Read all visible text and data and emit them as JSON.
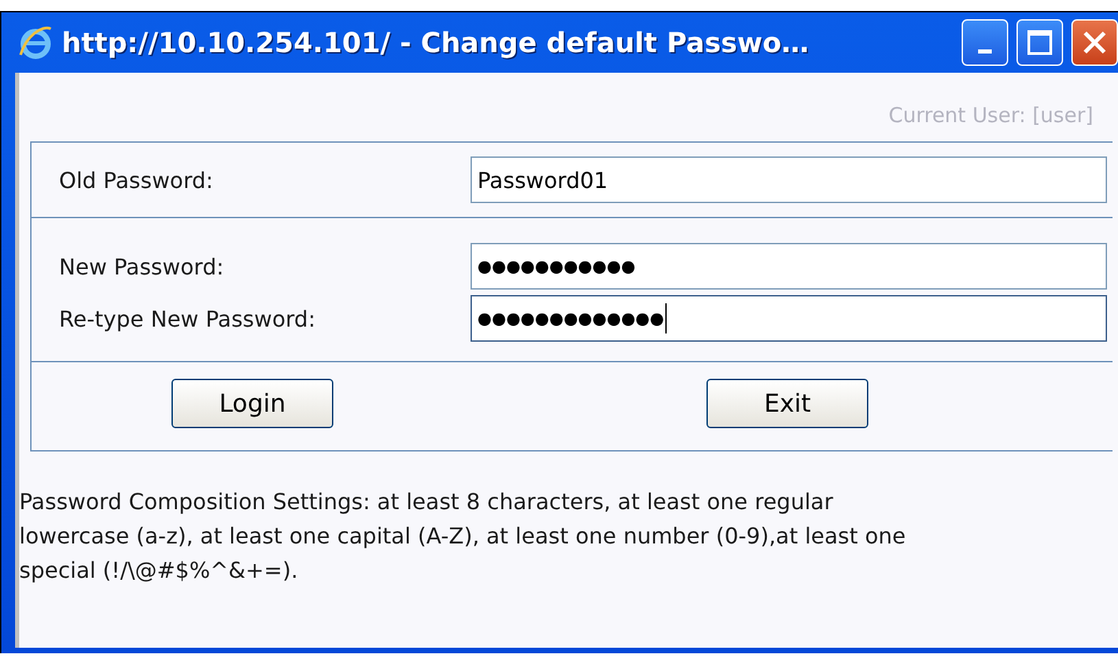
{
  "window": {
    "title": "http://10.10.254.101/ - Change default Passwo…"
  },
  "current_user": "Current User: [user]",
  "fields": [
    {
      "label": "Old Password:",
      "value": "Password01",
      "focused": false
    },
    {
      "label": "New Password:",
      "value": "●●●●●●●●●●●",
      "focused": false
    },
    {
      "label": "Re-type New Password:",
      "value": "●●●●●●●●●●●●●",
      "focused": true
    }
  ],
  "buttons": [
    "Login",
    "Exit"
  ],
  "note": "Password Composition Settings: at least 8 characters, at least one regular lowercase (a-z), at least one capital (A-Z), at least one number (0-9),at least one special (!/\\@#$%^&+=)."
}
